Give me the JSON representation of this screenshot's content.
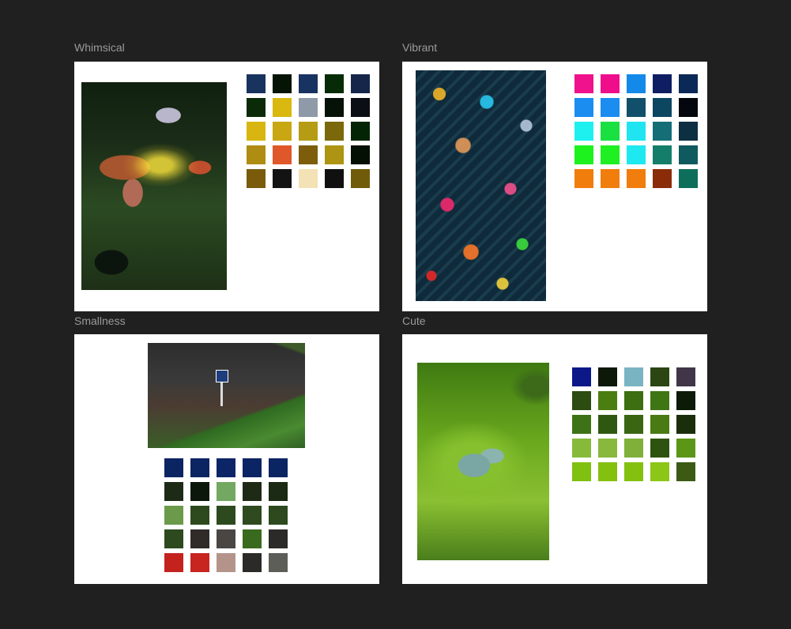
{
  "frames": [
    {
      "label": "Whimsical",
      "swatches": [
        "#19335f",
        "#061406",
        "#183362",
        "#062b06",
        "#15264a",
        "#0b2b08",
        "#d9b80f",
        "#8e9aa8",
        "#061108",
        "#0b0e14",
        "#d8b60f",
        "#c9a712",
        "#b69c14",
        "#7a680a",
        "#032506",
        "#ae8d12",
        "#e0582a",
        "#7d5d0c",
        "#ad9412",
        "#031003",
        "#7a5b0c",
        "#131313",
        "#f2e2b5",
        "#101010",
        "#6f5b09"
      ]
    },
    {
      "label": "Vibrant",
      "swatches": [
        "#f0118c",
        "#ef0d8c",
        "#1389ea",
        "#0f1e62",
        "#0b2956",
        "#1b8cf0",
        "#1b8cf0",
        "#124f6a",
        "#0d4661",
        "#05070f",
        "#1ef0f0",
        "#1ae042",
        "#20e4f0",
        "#156e76",
        "#0d2f42",
        "#1ef21e",
        "#1ef021",
        "#1ee8f0",
        "#157e6a",
        "#0f5a5e",
        "#f07d0c",
        "#f07d0c",
        "#f07d0c",
        "#8a2c08",
        "#0e6e5c"
      ]
    },
    {
      "label": "Smallness",
      "swatches": [
        "#0b2462",
        "#0b2462",
        "#0b2566",
        "#0b2464",
        "#0b2462",
        "#1d2b16",
        "#0c170c",
        "#72a862",
        "#1e2a16",
        "#1a2a14",
        "#6a9a4a",
        "#2c4a1e",
        "#2d4a1e",
        "#2e4a1e",
        "#2c4a1e",
        "#2c4a1e",
        "#302a28",
        "#4a4644",
        "#3a6a1e",
        "#2c2a28",
        "#c4221c",
        "#c82420",
        "#b4948a",
        "#2c2a28",
        "#5e5e58"
      ]
    },
    {
      "label": "Cute",
      "swatches": [
        "#0c1888",
        "#0e1808",
        "#7ab4c2",
        "#2b4612",
        "#403648",
        "#2c4c10",
        "#4a7e10",
        "#3d6e12",
        "#3e7614",
        "#0c1a08",
        "#3e7216",
        "#2e5810",
        "#3a6614",
        "#4a7a14",
        "#1a2e0c",
        "#88ba3a",
        "#88b83c",
        "#80b03a",
        "#2e5210",
        "#5c9616",
        "#80c010",
        "#84c010",
        "#84c010",
        "#8cc616",
        "#3c5a14"
      ]
    }
  ]
}
